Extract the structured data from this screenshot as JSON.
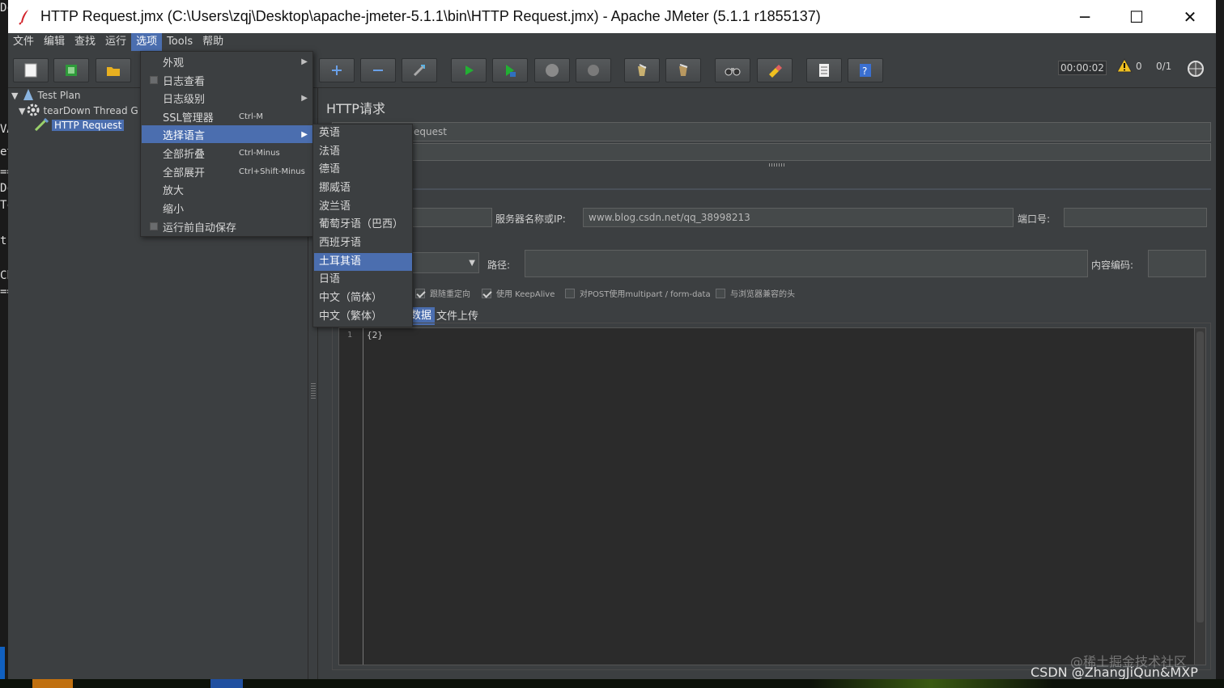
{
  "window": {
    "title": "HTTP Request.jmx (C:\\Users\\zqj\\Desktop\\apache-jmeter-5.1.1\\bin\\HTTP Request.jmx) - Apache JMeter (5.1.1 r1855137)",
    "minimize": "─",
    "maximize": "☐",
    "close": "✕"
  },
  "desktop_fragments": [
    "Dc",
    "VA",
    "et",
    "==",
    "Dc",
    "Tc",
    "t",
    "Ch",
    "=="
  ],
  "menubar": [
    "文件",
    "编辑",
    "查找",
    "运行",
    "选项",
    "Tools",
    "帮助"
  ],
  "toolbar": {
    "timer": "00:00:02",
    "warnings": "0",
    "threads": "0/1",
    "buttons": [
      "new-icon",
      "templates-icon",
      "open-icon",
      "add-icon",
      "remove-icon",
      "toggle-icon",
      "start-icon",
      "start-no-pause-icon",
      "stop-icon",
      "shutdown-icon",
      "clear-icon",
      "clear-all-icon",
      "search-icon",
      "reset-search-icon",
      "function-helper-icon",
      "help-icon"
    ]
  },
  "tree": {
    "test_plan": "Test Plan",
    "teardown": "tearDown Thread G",
    "http_request": "HTTP Request"
  },
  "options_menu": [
    {
      "label": "外观",
      "shortcut": "",
      "submenu": true,
      "check": false
    },
    {
      "label": "日志查看",
      "shortcut": "",
      "submenu": false,
      "check": true
    },
    {
      "label": "日志级别",
      "shortcut": "",
      "submenu": true,
      "check": false
    },
    {
      "label": "SSL管理器",
      "shortcut": "Ctrl-M",
      "submenu": false,
      "check": false
    },
    {
      "label": "选择语言",
      "shortcut": "",
      "submenu": true,
      "check": false,
      "highlighted": true
    },
    {
      "label": "全部折叠",
      "shortcut": "Ctrl-Minus",
      "submenu": false,
      "check": false
    },
    {
      "label": "全部展开",
      "shortcut": "Ctrl+Shift-Minus",
      "submenu": false,
      "check": false
    },
    {
      "label": "放大",
      "shortcut": "",
      "submenu": false,
      "check": false
    },
    {
      "label": "缩小",
      "shortcut": "",
      "submenu": false,
      "check": false
    },
    {
      "label": "运行前自动保存",
      "shortcut": "",
      "submenu": false,
      "check": true
    }
  ],
  "language_menu": [
    {
      "label": "英语"
    },
    {
      "label": "法语"
    },
    {
      "label": "德语"
    },
    {
      "label": "挪威语"
    },
    {
      "label": "波兰语"
    },
    {
      "label": "葡萄牙语（巴西）"
    },
    {
      "label": "西班牙语"
    },
    {
      "label": "土耳其语",
      "highlighted": true
    },
    {
      "label": "日语"
    },
    {
      "label": "中文（简体）"
    },
    {
      "label": "中文（繁体）"
    }
  ],
  "main": {
    "section_title": "HTTP请求",
    "name_value": "equest",
    "server_label": "服务器名称或IP:",
    "server_value": "www.blog.csdn.net/qq_38998213",
    "port_label": "端口号:",
    "path_label": "路径:",
    "encoding_label": "内容编码:",
    "checkboxes": [
      {
        "label": "跟随重定向",
        "checked": true
      },
      {
        "label": "使用 KeepAlive",
        "checked": true
      },
      {
        "label": "对POST使用multipart / form-data",
        "checked": false
      },
      {
        "label": "与浏览器兼容的头",
        "checked": false
      }
    ],
    "tabs": [
      "数据",
      "文件上传"
    ],
    "editor_line": "1",
    "editor_code": "{2}"
  },
  "watermark": {
    "site": "@稀土掘金技术社区",
    "author": "CSDN @ZhangJiQun&MXP"
  },
  "colors": {
    "background": "#3c3f41",
    "highlight": "#4b6eaf",
    "field": "#45494a"
  }
}
